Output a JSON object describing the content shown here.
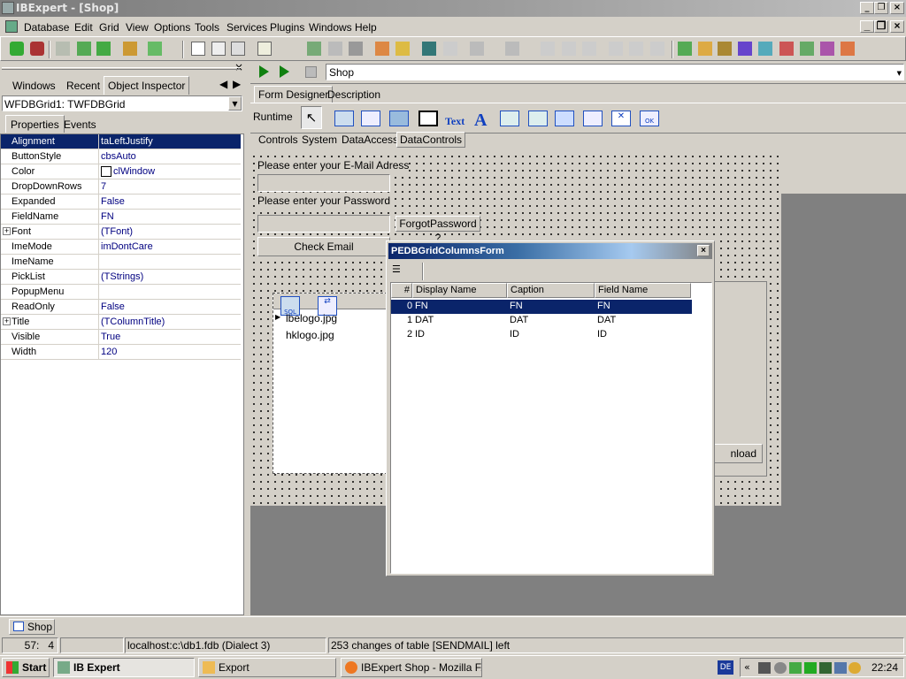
{
  "window": {
    "title": "IBExpert - [Shop]"
  },
  "menu": [
    "Database",
    "Edit",
    "Grid",
    "View",
    "Options",
    "Tools",
    "Services",
    "Plugins",
    "Windows",
    "Help"
  ],
  "left_panel": {
    "tabs": [
      "Windows",
      "Recent",
      "Object Inspector"
    ],
    "object_select": "WFDBGrid1: TWFDBGrid",
    "sub_tabs": [
      "Properties",
      "Events"
    ],
    "properties": [
      {
        "name": "Alignment",
        "value": "taLeftJustify",
        "selected": true
      },
      {
        "name": "ButtonStyle",
        "value": "cbsAuto"
      },
      {
        "name": "Color",
        "value": "clWindow"
      },
      {
        "name": "DropDownRows",
        "value": "7"
      },
      {
        "name": "Expanded",
        "value": "False"
      },
      {
        "name": "FieldName",
        "value": "FN"
      },
      {
        "name": "Font",
        "value": "(TFont)",
        "expand": true
      },
      {
        "name": "ImeMode",
        "value": "imDontCare"
      },
      {
        "name": "ImeName",
        "value": ""
      },
      {
        "name": "PickList",
        "value": "(TStrings)"
      },
      {
        "name": "PopupMenu",
        "value": ""
      },
      {
        "name": "ReadOnly",
        "value": "False"
      },
      {
        "name": "Title",
        "value": "(TColumnTitle)",
        "expand": true
      },
      {
        "name": "Visible",
        "value": "True"
      },
      {
        "name": "Width",
        "value": "120"
      }
    ]
  },
  "editor": {
    "form_name": "Shop",
    "tabs": [
      "Form Designer",
      "Description"
    ],
    "runtime_label": "Runtime",
    "palette_tabs": [
      "Controls",
      "System",
      "DataAccess",
      "DataControls"
    ],
    "text_tool": "Text",
    "form": {
      "email_label": "Please enter your E-Mail Adress",
      "password_label": "Please enter your Password",
      "forgot_button": "ForgotPassword ?",
      "check_button": "Check Email",
      "download_button": "nload",
      "grid_rows": [
        "lbelogo.jpg",
        "hklogo.jpg"
      ]
    }
  },
  "dialog": {
    "title": "PEDBGridColumnsForm",
    "columns": [
      "#",
      "Display Name",
      "Caption",
      "Field Name"
    ],
    "rows": [
      {
        "idx": "0",
        "display": "FN",
        "caption": "FN",
        "field": "FN",
        "selected": true
      },
      {
        "idx": "1",
        "display": "DAT",
        "caption": "DAT",
        "field": "DAT"
      },
      {
        "idx": "2",
        "display": "ID",
        "caption": "ID",
        "field": "ID"
      }
    ]
  },
  "bottom_tab": "Shop",
  "status": {
    "position": "57:   4",
    "connection": "localhost:c:\\db1.fdb (Dialect 3)",
    "message": "253 changes of table [SENDMAIL] left"
  },
  "taskbar": {
    "start": "Start",
    "tasks": [
      "IB Expert",
      "Export",
      "IBExpert Shop - Mozilla F..."
    ],
    "tray_lang": "DE",
    "clock": "22:24"
  },
  "colors": {
    "selection": "#0a246a",
    "face": "#d4d0c8",
    "desktop": "#808080"
  }
}
